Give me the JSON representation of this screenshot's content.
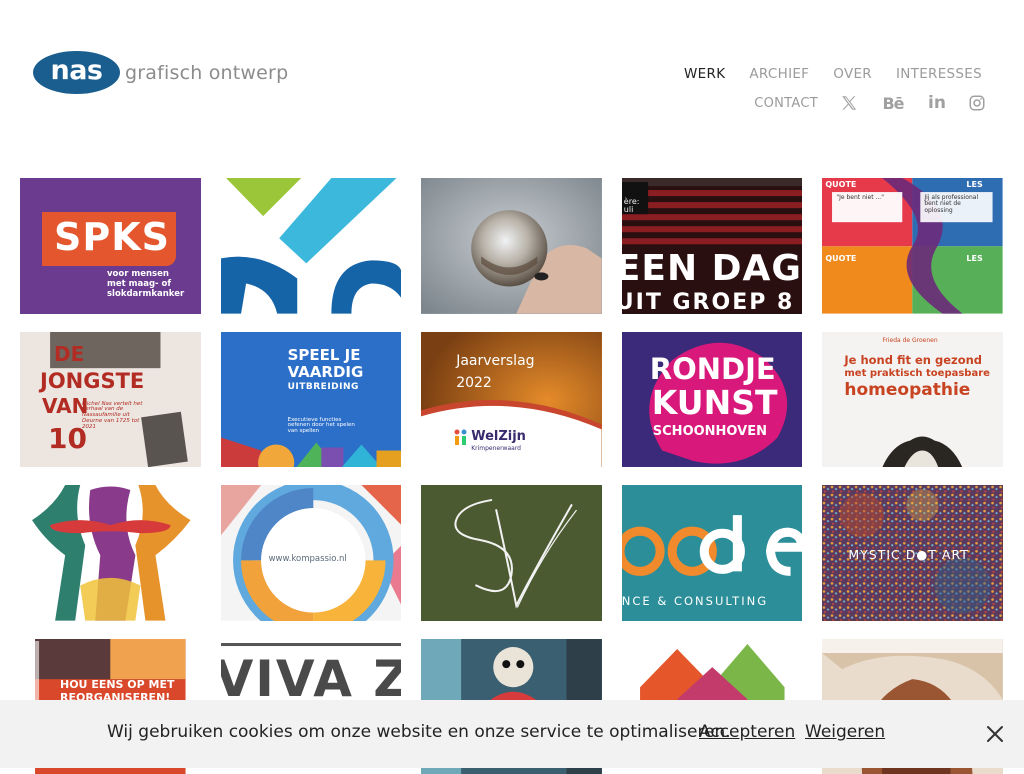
{
  "header": {
    "logo_mark": "nas",
    "logo_text": "grafisch ontwerp",
    "nav": [
      {
        "label": "WERK",
        "active": true
      },
      {
        "label": "ARCHIEF",
        "active": false
      },
      {
        "label": "OVER",
        "active": false
      },
      {
        "label": "INTERESSES",
        "active": false
      }
    ],
    "contact_label": "CONTACT",
    "social": [
      "x-icon",
      "behance-icon",
      "linkedin-icon",
      "instagram-icon"
    ],
    "behance_text": "Bē",
    "linkedin_text": "in"
  },
  "tiles": [
    {
      "id": "spks",
      "text_main": "SPKS",
      "text_sub1": "voor mensen",
      "text_sub2": "met maag- of",
      "text_sub3": "slokdarmkanker"
    },
    {
      "id": "shapes-blue"
    },
    {
      "id": "glass-ball"
    },
    {
      "id": "een-dag",
      "line1": "EEN DAG",
      "line2": "UIT GROEP 8",
      "sign": "ère: uli"
    },
    {
      "id": "quote-les",
      "q1": "QUOTE",
      "l1": "LES",
      "q2": "QUOTE",
      "l2": "LES",
      "body1": "\"Je bent niet ...\"",
      "body2": "Jij als professional bent niet de oplossing"
    },
    {
      "id": "jongste",
      "line1": "DE",
      "line2": "JONGSTE",
      "line3": "VAN",
      "line4": "10",
      "sub": "Michel Nas vertelt het verhaal van de Nassaufamilie uit Deurne van 1725 tot 2021"
    },
    {
      "id": "speel",
      "line1": "SPEEL JE",
      "line2": "VAARDIG",
      "line3": "UITBREIDING",
      "sub": "Executieve functies oefenen door het spelen van spellen"
    },
    {
      "id": "jaarverslag",
      "line1": "Jaarverslag",
      "line2": "2022",
      "brand": "WelZijn",
      "brand_sub": "Krimpenerwaard"
    },
    {
      "id": "rondje",
      "line1": "RONDJE",
      "line2": "KUNST",
      "line3": "SCHOONHOVEN"
    },
    {
      "id": "hond",
      "line1": "Je hond fit en gezond",
      "line2": "met praktisch toepasbare",
      "line3": "homeopathie",
      "author": "Frieda de Groenen"
    },
    {
      "id": "figures"
    },
    {
      "id": "kompassio",
      "url": "www.kompassio.nl"
    },
    {
      "id": "monogram"
    },
    {
      "id": "oode",
      "letters": "ode",
      "sub": "NCE & CONSULTING"
    },
    {
      "id": "mystic",
      "text": "MYSTIC D●T ART"
    },
    {
      "id": "reorganiseren",
      "line1": "HOU EENS OP MET",
      "line2": "REORGANISEREN!"
    },
    {
      "id": "viva",
      "text": "VIVA Z"
    },
    {
      "id": "street-art"
    },
    {
      "id": "houses"
    },
    {
      "id": "portrait"
    }
  ],
  "cookie": {
    "message": "Wij gebruiken cookies om onze website en onze service te optimaliseren.",
    "accept": "Accepteren",
    "decline": "Weigeren"
  },
  "colors": {
    "brand_blue": "#1a5e8f",
    "spks_purple": "#6a3b8f",
    "spks_orange": "#e4572e",
    "rondje_pink": "#d8187a",
    "cookie_bg": "#f2f2f2"
  }
}
